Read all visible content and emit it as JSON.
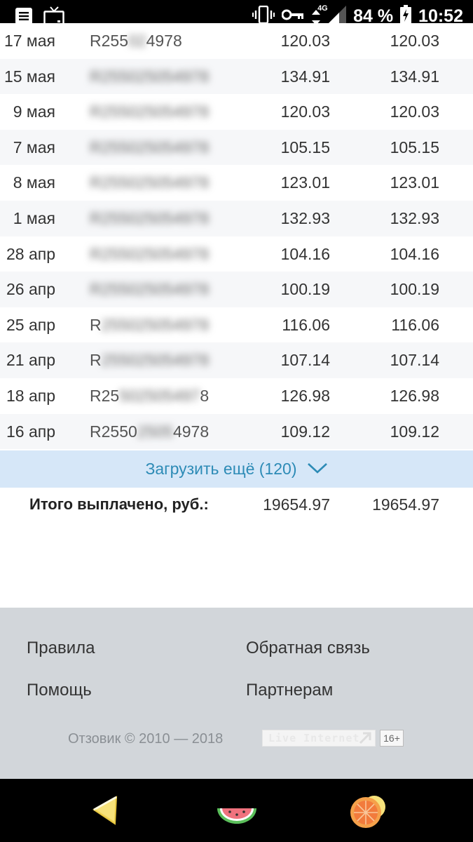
{
  "status_bar": {
    "network": "4G",
    "battery": "84 %",
    "time": "10:52",
    "icons": [
      "menu-icon",
      "tv-icon",
      "vibrate-icon",
      "key-icon",
      "data-arrows-icon",
      "signal-icon",
      "battery-icon"
    ]
  },
  "rows": [
    {
      "date": "17 мая",
      "id_sharp": "R255",
      "id_blur": "02",
      "id_tail": "4978",
      "v1": "120.03",
      "v2": "120.03"
    },
    {
      "date": "15 мая",
      "id_sharp": "",
      "id_blur": "R255025054978",
      "id_tail": "",
      "v1": "134.91",
      "v2": "134.91"
    },
    {
      "date": "9 мая",
      "id_sharp": "",
      "id_blur": "R255025054978",
      "id_tail": "",
      "v1": "120.03",
      "v2": "120.03"
    },
    {
      "date": "7 мая",
      "id_sharp": "",
      "id_blur": "R255025054978",
      "id_tail": "",
      "v1": "105.15",
      "v2": "105.15"
    },
    {
      "date": "8 мая",
      "id_sharp": "",
      "id_blur": "R255025054978",
      "id_tail": "",
      "v1": "123.01",
      "v2": "123.01"
    },
    {
      "date": "1 мая",
      "id_sharp": "",
      "id_blur": "R255025054978",
      "id_tail": "",
      "v1": "132.93",
      "v2": "132.93"
    },
    {
      "date": "28 апр",
      "id_sharp": "",
      "id_blur": "R255025054978",
      "id_tail": "",
      "v1": "104.16",
      "v2": "104.16"
    },
    {
      "date": "26 апр",
      "id_sharp": "",
      "id_blur": "R255025054978",
      "id_tail": "",
      "v1": "100.19",
      "v2": "100.19"
    },
    {
      "date": "25 апр",
      "id_sharp": "R",
      "id_blur": "255025054978",
      "id_tail": "",
      "v1": "116.06",
      "v2": "116.06"
    },
    {
      "date": "21 апр",
      "id_sharp": "R",
      "id_blur": "255025054978",
      "id_tail": "",
      "v1": "107.14",
      "v2": "107.14"
    },
    {
      "date": "18 апр",
      "id_sharp": "R25",
      "id_blur": "502505497",
      "id_tail": "8",
      "v1": "126.98",
      "v2": "126.98"
    },
    {
      "date": "16 апр",
      "id_sharp": "R2550",
      "id_blur": "2505",
      "id_tail": "4978",
      "v1": "109.12",
      "v2": "109.12"
    }
  ],
  "load_more": {
    "label": "Загрузить ещё (120)",
    "icon": "chevron-down-icon",
    "color": "#2d8bb6"
  },
  "total": {
    "label": "Итого выплачено, руб.:",
    "v1": "19654.97",
    "v2": "19654.97"
  },
  "footer": {
    "links": [
      "Правила",
      "Обратная связь",
      "Помощь",
      "Партнерам"
    ],
    "copyright": "Отзовик © 2010 — 2018",
    "counter_label": "Live Internet",
    "age_badge": "16+"
  },
  "nav": {
    "buttons": [
      "lemon-icon",
      "watermelon-icon",
      "orange-icon"
    ]
  }
}
